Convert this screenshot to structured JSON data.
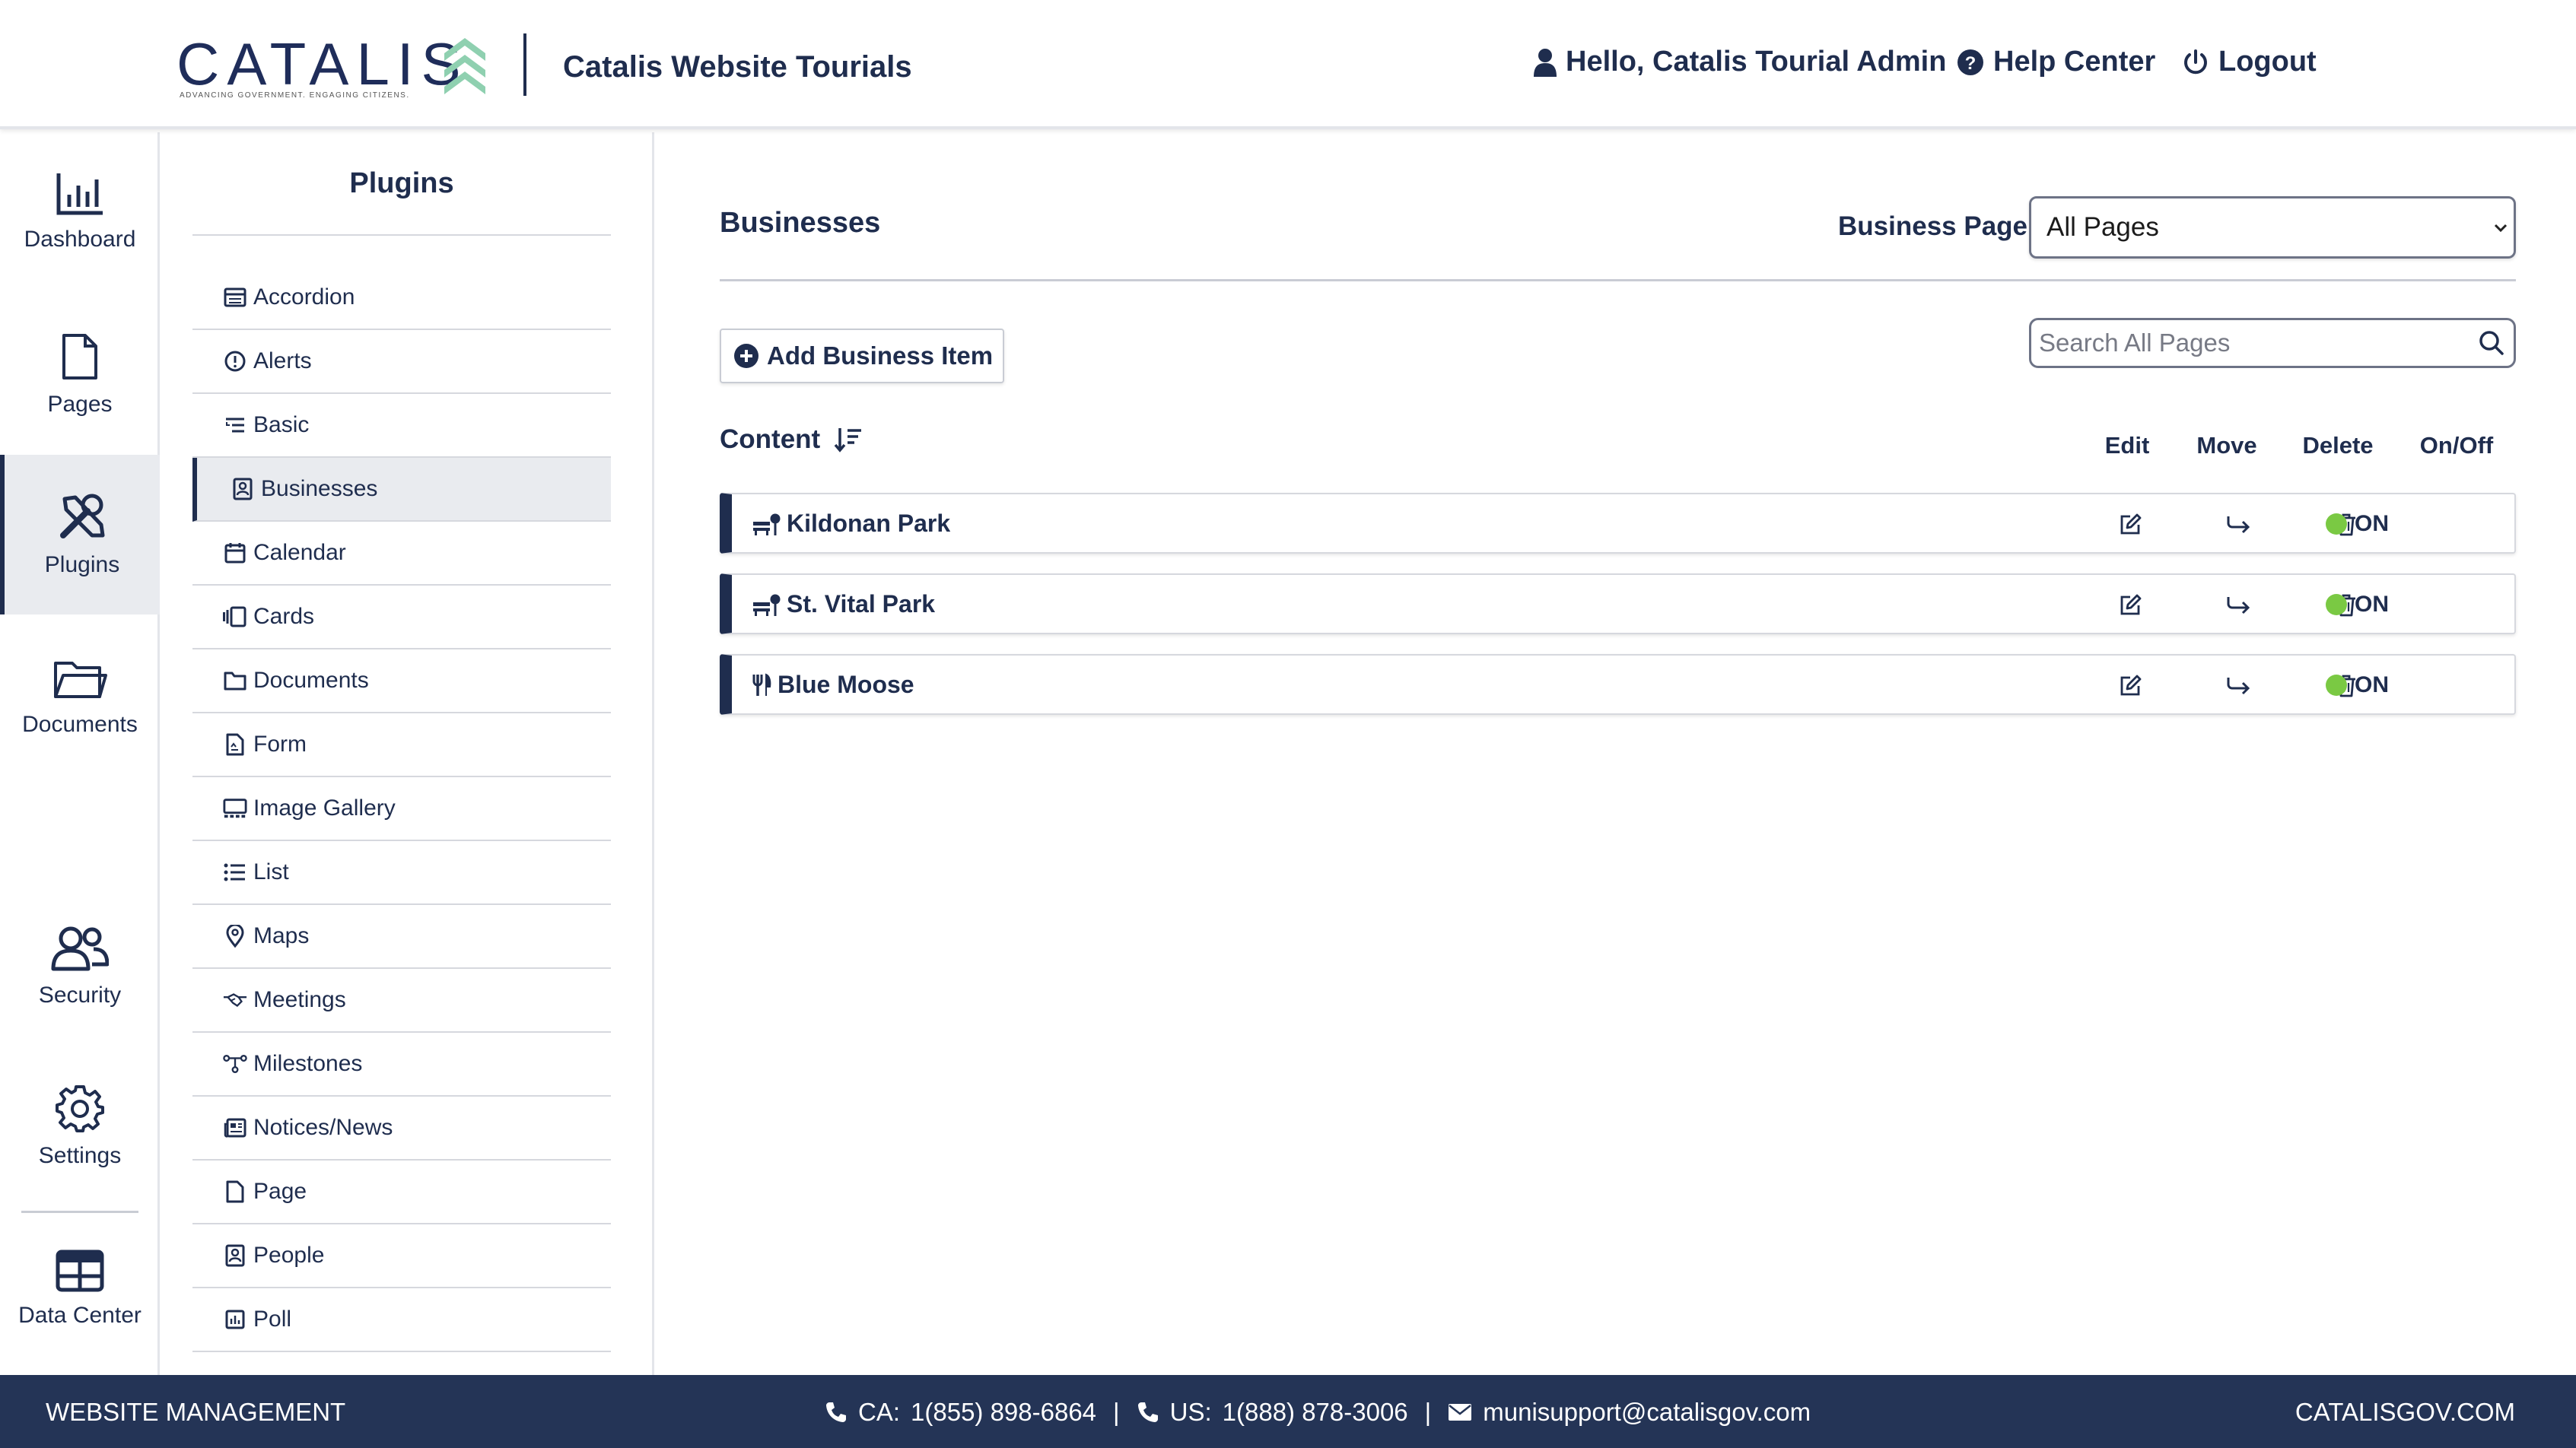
{
  "header": {
    "logo_text": "CATALIS",
    "logo_tagline": "ADVANCING GOVERNMENT. ENGAGING CITIZENS.",
    "app_title": "Catalis Website Tourials",
    "greeting": "Hello, Catalis Tourial Admin",
    "help": "Help Center",
    "logout": "Logout"
  },
  "nav": {
    "items": [
      {
        "label": "Dashboard",
        "icon": "dashboard-chart-icon"
      },
      {
        "label": "Pages",
        "icon": "page-icon"
      },
      {
        "label": "Plugins",
        "icon": "tools-icon",
        "active": true
      },
      {
        "label": "Documents",
        "icon": "folder-icon"
      },
      {
        "label": "Security",
        "icon": "users-icon"
      },
      {
        "label": "Settings",
        "icon": "gear-icon"
      },
      {
        "label": "Data Center",
        "icon": "table-icon"
      }
    ]
  },
  "plugins": {
    "title": "Plugins",
    "items": [
      {
        "label": "Accordion",
        "icon": "accordion-icon"
      },
      {
        "label": "Alerts",
        "icon": "alert-icon"
      },
      {
        "label": "Basic",
        "icon": "basic-list-icon"
      },
      {
        "label": "Businesses",
        "icon": "business-icon",
        "active": true
      },
      {
        "label": "Calendar",
        "icon": "calendar-icon"
      },
      {
        "label": "Cards",
        "icon": "cards-icon"
      },
      {
        "label": "Documents",
        "icon": "folder-icon"
      },
      {
        "label": "Form",
        "icon": "form-icon"
      },
      {
        "label": "Image Gallery",
        "icon": "gallery-icon"
      },
      {
        "label": "List",
        "icon": "list-icon"
      },
      {
        "label": "Maps",
        "icon": "map-pin-icon"
      },
      {
        "label": "Meetings",
        "icon": "handshake-icon"
      },
      {
        "label": "Milestones",
        "icon": "milestones-icon"
      },
      {
        "label": "Notices/News",
        "icon": "news-icon"
      },
      {
        "label": "Page",
        "icon": "page-icon"
      },
      {
        "label": "People",
        "icon": "people-icon"
      },
      {
        "label": "Poll",
        "icon": "poll-icon"
      }
    ]
  },
  "main": {
    "title": "Businesses",
    "business_page_label": "Business Page",
    "business_page_value": "All Pages",
    "add_button": "Add Business Item",
    "search_placeholder": "Search All Pages",
    "content_label": "Content",
    "columns": {
      "edit": "Edit",
      "move": "Move",
      "delete": "Delete",
      "onoff": "On/Off"
    },
    "rows": [
      {
        "name": "Kildonan Park",
        "icon": "park-bench-icon",
        "status": "ON"
      },
      {
        "name": "St. Vital Park",
        "icon": "park-bench-icon",
        "status": "ON"
      },
      {
        "name": "Blue Moose",
        "icon": "utensils-icon",
        "status": "ON"
      }
    ]
  },
  "footer": {
    "left": "WEBSITE MANAGEMENT",
    "ca_label": "CA:",
    "ca_phone": "1(855) 898-6864",
    "us_label": "US:",
    "us_phone": "1(888) 878-3006",
    "email": "munisupport@catalisgov.com",
    "right": "CATALISGOV.COM",
    "separator": "|"
  },
  "colors": {
    "navy": "#1f2d4e",
    "footer": "#243456",
    "status_on": "#7ac943",
    "logo_green": "#8fd0b0"
  }
}
